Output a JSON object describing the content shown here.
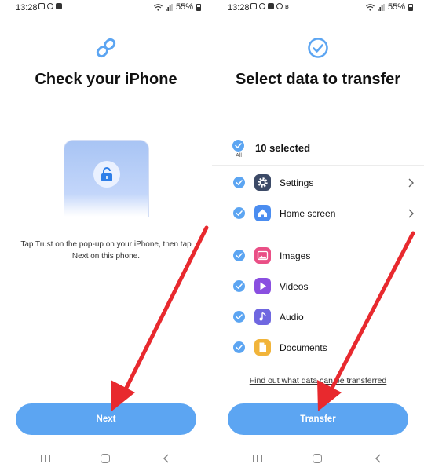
{
  "left": {
    "status": {
      "time": "13:28",
      "battery": "55%"
    },
    "title": "Check your iPhone",
    "instruction": "Tap Trust on the pop-up on your iPhone, then tap Next on this phone.",
    "next_label": "Next"
  },
  "right": {
    "status": {
      "time": "13:28",
      "battery": "55%"
    },
    "title": "Select data to transfer",
    "all_label": "All",
    "selected_count": "10 selected",
    "items": [
      {
        "label": "Settings",
        "icon": "gear-icon",
        "color": "#3c4a67",
        "has_chevron": true
      },
      {
        "label": "Home screen",
        "icon": "home-icon",
        "color": "#4b8df0",
        "has_chevron": true
      },
      {
        "label": "Images",
        "icon": "image-icon",
        "color": "#ea4f86",
        "has_chevron": false
      },
      {
        "label": "Videos",
        "icon": "play-icon",
        "color": "#8a4fe0",
        "has_chevron": false
      },
      {
        "label": "Audio",
        "icon": "music-icon",
        "color": "#6f67e0",
        "has_chevron": false
      },
      {
        "label": "Documents",
        "icon": "document-icon",
        "color": "#f1b43a",
        "has_chevron": false
      }
    ],
    "link": "Find out what data can be transferred",
    "transfer_label": "Transfer"
  },
  "colors": {
    "accent": "#5ca5f2",
    "arrow": "#e8292e"
  }
}
